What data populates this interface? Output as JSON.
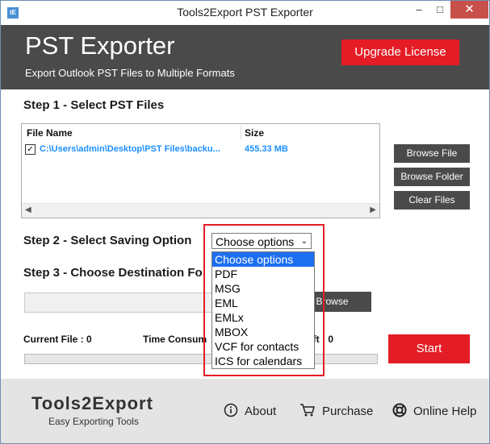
{
  "window": {
    "title": "Tools2Export PST Exporter",
    "app_icon": "tE",
    "minimize": "–",
    "maximize": "□",
    "close": "✕"
  },
  "header": {
    "title": "PST Exporter",
    "subtitle": "Export Outlook PST Files to Multiple Formats",
    "upgrade_label": "Upgrade License"
  },
  "step1": {
    "label": "Step 1 - Select PST Files",
    "columns": [
      "File Name",
      "Size"
    ],
    "files": [
      {
        "checked": true,
        "path": "C:\\Users\\admin\\Desktop\\PST Files\\backu...",
        "size": "455.33 MB"
      }
    ],
    "browse_file": "Browse File",
    "browse_folder": "Browse Folder",
    "clear_files": "Clear Files"
  },
  "step2": {
    "label": "Step 2 - Select Saving Option",
    "selected": "Choose options",
    "options": [
      "Choose options",
      "PDF",
      "MSG",
      "EML",
      "EMLx",
      "MBOX",
      "VCF for contacts",
      "ICS for calendars"
    ]
  },
  "step3": {
    "label": "Step 3 - Choose Destination Fo",
    "browse_label": "Browse"
  },
  "status": {
    "current_file": "Current File : 0",
    "time_consumed": "Time Consum",
    "time_left": "eft : 0",
    "progress": 0
  },
  "start_label": "Start",
  "footer": {
    "brand": "Tools2Export",
    "tagline": "Easy Exporting Tools",
    "about": "About",
    "purchase": "Purchase",
    "help": "Online Help"
  },
  "colors": {
    "accent_red": "#e31c25",
    "header_bg": "#4a4a4a",
    "link_blue": "#1e90ff",
    "select_blue": "#1e6ff0"
  }
}
